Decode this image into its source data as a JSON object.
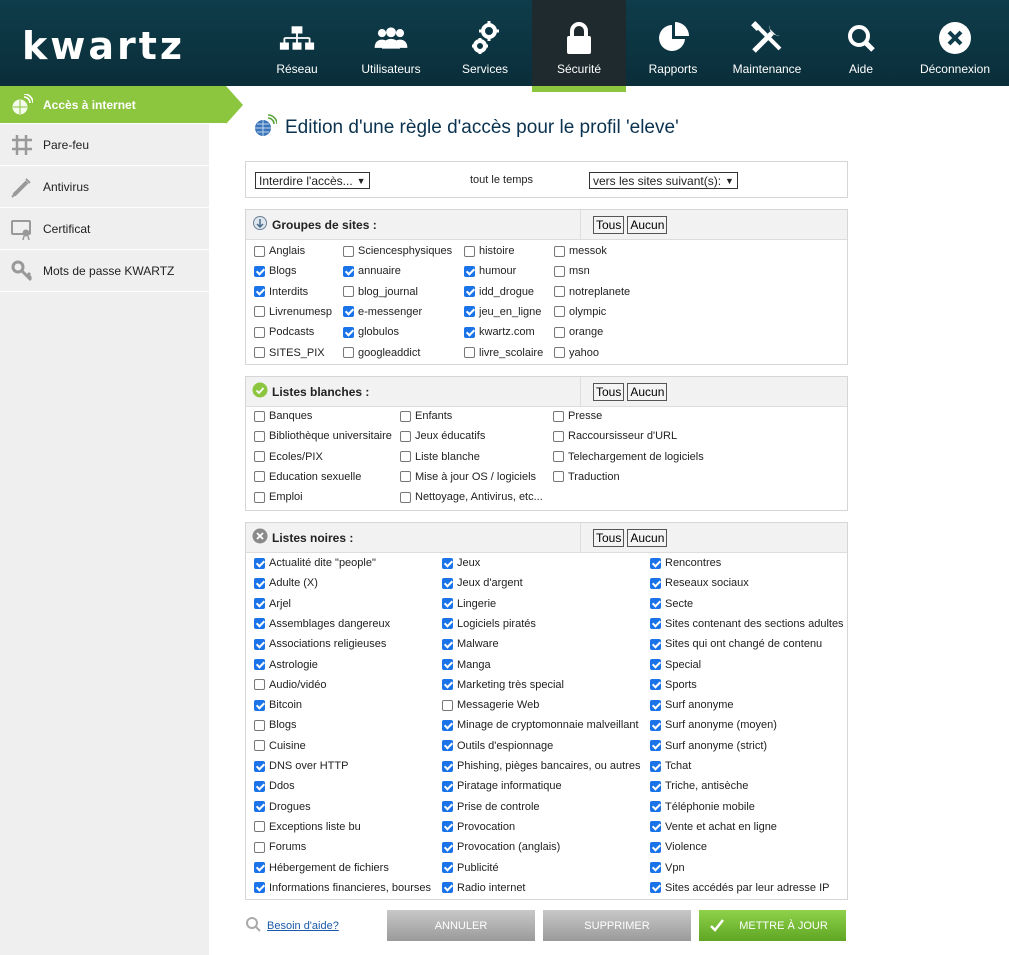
{
  "header": {
    "logo": "kwartz",
    "nav": [
      {
        "label": "Réseau",
        "icon": "network-icon"
      },
      {
        "label": "Utilisateurs",
        "icon": "users-icon"
      },
      {
        "label": "Services",
        "icon": "gears-icon"
      },
      {
        "label": "Sécurité",
        "icon": "lock-icon",
        "active": true
      },
      {
        "label": "Rapports",
        "icon": "pie-chart-icon"
      },
      {
        "label": "Maintenance",
        "icon": "tools-icon"
      },
      {
        "label": "Aide",
        "icon": "search-icon"
      },
      {
        "label": "Déconnexion",
        "icon": "close-circle-icon"
      }
    ]
  },
  "sidebar": {
    "items": [
      {
        "label": "Accès à internet",
        "icon": "globe-icon",
        "active": true
      },
      {
        "label": "Pare-feu",
        "icon": "firewall-icon"
      },
      {
        "label": "Antivirus",
        "icon": "syringe-icon"
      },
      {
        "label": "Certificat",
        "icon": "certificate-icon"
      },
      {
        "label": "Mots de passe KWARTZ",
        "icon": "key-icon"
      }
    ]
  },
  "page": {
    "title": "Edition d'une règle d'accès pour le profil 'eleve'"
  },
  "rule": {
    "action": "Interdire l'accès...",
    "time": "tout le temps",
    "target": "vers les sites suivant(s):"
  },
  "buttons": {
    "all": "Tous",
    "none": "Aucun"
  },
  "groups": {
    "title": "Groupes de sites :",
    "columns": [
      [
        [
          "Anglais",
          false
        ],
        [
          "Blogs",
          true
        ],
        [
          "Interdits",
          true
        ],
        [
          "Livrenumesp",
          false
        ],
        [
          "Podcasts",
          false
        ],
        [
          "SITES_PIX",
          false
        ]
      ],
      [
        [
          "Sciencesphysiques",
          false
        ],
        [
          "annuaire",
          true
        ],
        [
          "blog_journal",
          false
        ],
        [
          "e-messenger",
          true
        ],
        [
          "globulos",
          true
        ],
        [
          "googleaddict",
          false
        ]
      ],
      [
        [
          "histoire",
          false
        ],
        [
          "humour",
          true
        ],
        [
          "idd_drogue",
          true
        ],
        [
          "jeu_en_ligne",
          true
        ],
        [
          "kwartz.com",
          true
        ],
        [
          "livre_scolaire",
          false
        ]
      ],
      [
        [
          "messok",
          false
        ],
        [
          "msn",
          false
        ],
        [
          "notreplanete",
          false
        ],
        [
          "olympic",
          false
        ],
        [
          "orange",
          false
        ],
        [
          "yahoo",
          false
        ]
      ]
    ]
  },
  "whitelists": {
    "title": "Listes blanches :",
    "columns": [
      [
        [
          "Banques",
          false
        ],
        [
          "Bibliothèque universitaire",
          false
        ],
        [
          "Ecoles/PIX",
          false
        ],
        [
          "Education sexuelle",
          false
        ],
        [
          "Emploi",
          false
        ]
      ],
      [
        [
          "Enfants",
          false
        ],
        [
          "Jeux éducatifs",
          false
        ],
        [
          "Liste blanche",
          false
        ],
        [
          "Mise à jour OS / logiciels",
          false
        ],
        [
          "Nettoyage, Antivirus, etc...",
          false
        ]
      ],
      [
        [
          "Presse",
          false
        ],
        [
          "Raccoursisseur d'URL",
          false
        ],
        [
          "Telechargement de logiciels",
          false
        ],
        [
          "Traduction",
          false
        ]
      ]
    ]
  },
  "blacklists": {
    "title": "Listes noires :",
    "columns": [
      [
        [
          "Actualité dite \"people\"",
          true
        ],
        [
          "Adulte (X)",
          true
        ],
        [
          "Arjel",
          true
        ],
        [
          "Assemblages dangereux",
          true
        ],
        [
          "Associations religieuses",
          true
        ],
        [
          "Astrologie",
          true
        ],
        [
          "Audio/vidéo",
          false
        ],
        [
          "Bitcoin",
          true
        ],
        [
          "Blogs",
          false
        ],
        [
          "Cuisine",
          false
        ],
        [
          "DNS over HTTP",
          true
        ],
        [
          "Ddos",
          true
        ],
        [
          "Drogues",
          true
        ],
        [
          "Exceptions liste bu",
          false
        ],
        [
          "Forums",
          false
        ],
        [
          "Hébergement de fichiers",
          true
        ],
        [
          "Informations financieres, bourses",
          true
        ]
      ],
      [
        [
          "Jeux",
          true
        ],
        [
          "Jeux d'argent",
          true
        ],
        [
          "Lingerie",
          true
        ],
        [
          "Logiciels piratés",
          true
        ],
        [
          "Malware",
          true
        ],
        [
          "Manga",
          true
        ],
        [
          "Marketing très special",
          true
        ],
        [
          "Messagerie Web",
          false
        ],
        [
          "Minage de cryptomonnaie malveillant",
          true
        ],
        [
          "Outils d'espionnage",
          true
        ],
        [
          "Phishing, pièges bancaires, ou autres",
          true
        ],
        [
          "Piratage informatique",
          true
        ],
        [
          "Prise de controle",
          true
        ],
        [
          "Provocation",
          true
        ],
        [
          "Provocation (anglais)",
          true
        ],
        [
          "Publicité",
          true
        ],
        [
          "Radio internet",
          true
        ]
      ],
      [
        [
          "Rencontres",
          true
        ],
        [
          "Reseaux sociaux",
          true
        ],
        [
          "Secte",
          true
        ],
        [
          "Sites contenant des sections adultes",
          true
        ],
        [
          "Sites qui ont changé de contenu",
          true
        ],
        [
          "Special",
          true
        ],
        [
          "Sports",
          true
        ],
        [
          "Surf anonyme",
          true
        ],
        [
          "Surf anonyme (moyen)",
          true
        ],
        [
          "Surf anonyme (strict)",
          true
        ],
        [
          "Tchat",
          true
        ],
        [
          "Triche, antisèche",
          true
        ],
        [
          "Téléphonie mobile",
          true
        ],
        [
          "Vente et achat en ligne",
          true
        ],
        [
          "Violence",
          true
        ],
        [
          "Vpn",
          true
        ],
        [
          "Sites accédés par leur adresse IP",
          true
        ]
      ]
    ]
  },
  "footer": {
    "help": "Besoin d'aide?",
    "cancel": "ANNULER",
    "delete": "SUPPRIMER",
    "update": "METTRE À JOUR"
  }
}
